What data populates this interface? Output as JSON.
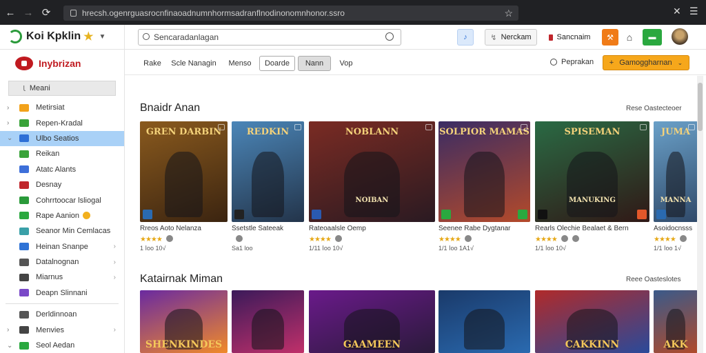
{
  "browser": {
    "url": "hrecsh.ogenrguasrocnfinaoadnumnhormsadranflnodinonomnhonor.ssro",
    "back": "←",
    "forward": "→",
    "reload": "⟳",
    "star": "☆"
  },
  "window": {
    "close": "✕",
    "menu": "☰"
  },
  "app": {
    "brand": "Koi Kpklin",
    "search_placeholder": "Sencaradanlagan",
    "header_buttons": {
      "pending": "Nerckam",
      "subscriptions": "Sancnaim"
    }
  },
  "sidebar": {
    "title": "Inybrizan",
    "filter": "Meani",
    "items": [
      {
        "label": "Metirsiat",
        "color": "#f2a21b",
        "arrow": "›"
      },
      {
        "label": "Repen-Kradal",
        "color": "#3aa33a",
        "arrow": "›"
      },
      {
        "label": "Ulbo Seatios",
        "color": "#2e6fd6",
        "arrow": "⌄"
      },
      {
        "label": "Reikan",
        "color": "#3aa33a",
        "arrow": ""
      },
      {
        "label": "Atatc Alants",
        "color": "#3d6fd9",
        "arrow": ""
      },
      {
        "label": "Desnay",
        "color": "#c0262c",
        "arrow": ""
      },
      {
        "label": "Cohrrtoocar lsliogal",
        "color": "#2a9a3a",
        "arrow": ""
      },
      {
        "label": "Rape Aanion",
        "color": "#2aa83f",
        "arrow": ""
      },
      {
        "label": "Seanor Min Cemlacas",
        "color": "#3aa0a8",
        "arrow": ""
      },
      {
        "label": "Heinan Snanpe",
        "color": "#2f73d6",
        "arrow": ""
      },
      {
        "label": "Datalnognan",
        "color": "#555555",
        "arrow": ""
      },
      {
        "label": "Miarnus",
        "color": "#444444",
        "arrow": ""
      },
      {
        "label": "Deapn Slinnani",
        "color": "#7a49c8",
        "arrow": ""
      }
    ],
    "items_bottom": [
      {
        "label": "Derldinnoan",
        "color": "#555555",
        "arrow": ""
      },
      {
        "label": "Menvies",
        "color": "#444444",
        "arrow": "›"
      },
      {
        "label": "Seol Aedan",
        "color": "#2aa83f",
        "arrow": "⌄"
      }
    ]
  },
  "tabs": [
    {
      "label": "Rake"
    },
    {
      "label": "Scle Nanagin"
    },
    {
      "label": "Menso"
    },
    {
      "label": "Doarde"
    },
    {
      "label": "Nann"
    },
    {
      "label": "Vop"
    }
  ],
  "actions": {
    "popular": "Peprakan",
    "games_button": "Gamoggharnan"
  },
  "sections": [
    {
      "title": "Bnaidr Anan",
      "see_all": "Rese Oastecteoer",
      "cards": [
        {
          "title": "Rreos Aoto Nelanza",
          "rating": "★★★★",
          "meta": "1 ⅼoo  10√"
        },
        {
          "title": "Ssetstle Sateeak",
          "rating": "",
          "meta": "Sa1 loo"
        },
        {
          "title": "Rateoaalsle Oemp",
          "rating": "★★★★",
          "meta": "1/11 ⅼoo  10√"
        },
        {
          "title": "Seenee Rabe Dygtanar",
          "rating": "★★★★",
          "meta": "1/1 ⅼoo  1A1√"
        },
        {
          "title": "Rearls Olechie Bealaet & Bern",
          "rating": "★★★★",
          "meta": "1/1 ⅼoo  10√"
        },
        {
          "title": "Asoidocnsss",
          "rating": "★★★★",
          "meta": "1/1 ⅼoo  1√"
        }
      ]
    },
    {
      "title": "Katairnak Miman",
      "see_all": "Reee Oasteslotes",
      "cards": [
        {
          "title": "SHENKINDES"
        },
        {
          "title": ""
        },
        {
          "title": "GAAMEEN"
        },
        {
          "title": ""
        },
        {
          "title": "CAKKINN"
        },
        {
          "title": "AKK"
        }
      ]
    }
  ],
  "thumb_titles": [
    "GREN DARBIN",
    "REDKIN",
    "NOBLANN",
    "SOLPIOR MAMAS",
    "SPISEMAN",
    "JUMA"
  ],
  "thumb_subs": [
    "",
    "",
    "NOIBAN",
    "",
    "MANUKING",
    "MANNA"
  ]
}
